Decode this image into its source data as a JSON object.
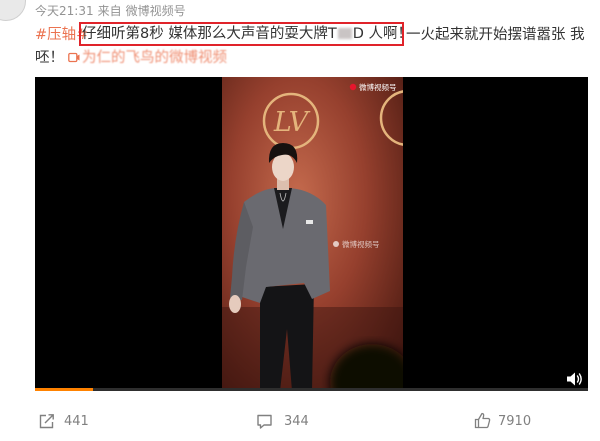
{
  "post": {
    "time": "今天21:31",
    "source_prefix": "来自",
    "source": "微博视频号",
    "hashtag": "#压轴#",
    "highlight_before": "仔细听第8秒 媒体那么大声音的耍大牌T",
    "highlight_after": "D 人啊！",
    "line1_rest": "一火起来就开始摆谱嚣张 我",
    "line2": "呸！",
    "video_link": "为仁的飞鸟的微博视频",
    "video_link_icon": "video-camera-icon"
  },
  "video": {
    "backdrop_logo": "LV",
    "watermark_top": "微博视频号",
    "watermark_mid": "微博视频号",
    "progress": 0.105,
    "speaker_icon": "speaker-icon"
  },
  "actions": {
    "share": {
      "icon": "share-icon",
      "count": "441"
    },
    "comment": {
      "icon": "comment-icon",
      "count": "344"
    },
    "like": {
      "icon": "thumbs-up-icon",
      "count": "7910"
    }
  },
  "colors": {
    "hashtag": "#eb7350",
    "highlight_border": "#e0232a",
    "meta": "#939393",
    "count": "#808080",
    "progress": "#ff8200",
    "link": "#eb7350"
  }
}
